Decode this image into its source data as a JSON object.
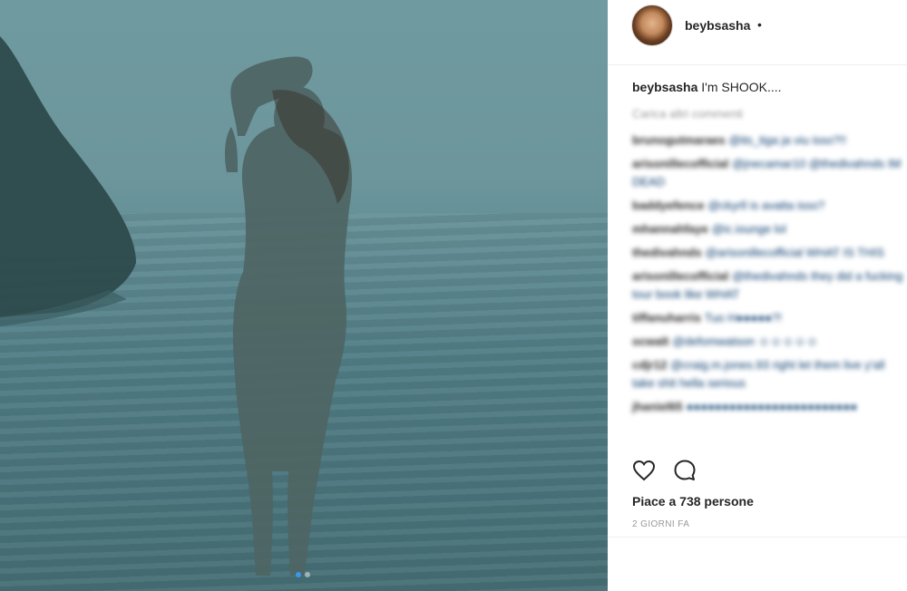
{
  "post": {
    "username": "beybsasha",
    "header_separator": "•",
    "caption_user": "beybsasha",
    "caption_text": "I'm SHOOK....",
    "load_more": "Carica altri commenti",
    "likes": "Piace a 738 persone",
    "time_ago": "2 GIORNI FA"
  },
  "comments": [
    {
      "user": "brunogutmaraes",
      "text": "@its_tiga ja viu isso?!!"
    },
    {
      "user": "arisonillecofficial",
      "text": "@jnecamar10 @thedivahnds IM DEAD"
    },
    {
      "user": "baddyefence",
      "text": "@ckyrll is avatta isso?"
    },
    {
      "user": "mhannahfaye",
      "text": "@ic.iounge lol"
    },
    {
      "user": "thedivahnds",
      "text": "@arisonillecofficial WHAT IS THIS"
    },
    {
      "user": "arisonillecofficial",
      "text": "@thedivahnds they did a fucking tour book like WHAT"
    },
    {
      "user": "tiffanuharris",
      "text": "Tuo H●●●●●?!"
    },
    {
      "user": "ocwalt",
      "text": "@defomwatson ☺☺☺☺☺"
    },
    {
      "user": "cdjr12",
      "text": "@craig.m.jones.93 right let them live y'all take shit hella serious"
    },
    {
      "user": "jhaniel65",
      "text": "●●●●●●●●●●●●●●●●●●●●●●●●"
    }
  ],
  "carousel": {
    "total": 2,
    "active": 0
  },
  "colors": {
    "accent": "#3897f0",
    "text": "#262626",
    "muted": "#999999",
    "link": "#003569"
  },
  "icons": [
    "heart-icon",
    "comment-icon"
  ]
}
